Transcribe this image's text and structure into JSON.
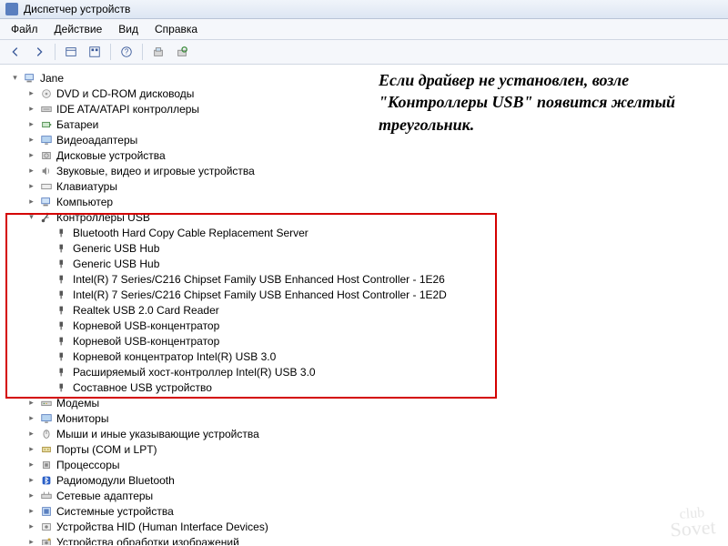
{
  "window": {
    "title": "Диспетчер устройств"
  },
  "menu": {
    "file": "Файл",
    "action": "Действие",
    "view": "Вид",
    "help": "Справка"
  },
  "tree": {
    "root": "Jane",
    "categories": [
      {
        "label": "DVD и CD-ROM дисководы",
        "icon": "disc"
      },
      {
        "label": "IDE ATA/ATAPI контроллеры",
        "icon": "ide"
      },
      {
        "label": "Батареи",
        "icon": "battery"
      },
      {
        "label": "Видеоадаптеры",
        "icon": "display"
      },
      {
        "label": "Дисковые устройства",
        "icon": "disk"
      },
      {
        "label": "Звуковые, видео и игровые устройства",
        "icon": "sound"
      },
      {
        "label": "Клавиатуры",
        "icon": "keyboard"
      },
      {
        "label": "Компьютер",
        "icon": "computer"
      },
      {
        "label": "Контроллеры USB",
        "icon": "usb",
        "expanded": true
      },
      {
        "label": "Модемы",
        "icon": "modem"
      },
      {
        "label": "Мониторы",
        "icon": "monitor"
      },
      {
        "label": "Мыши и иные указывающие устройства",
        "icon": "mouse"
      },
      {
        "label": "Порты (COM и LPT)",
        "icon": "port"
      },
      {
        "label": "Процессоры",
        "icon": "cpu"
      },
      {
        "label": "Радиомодули Bluetooth",
        "icon": "bluetooth"
      },
      {
        "label": "Сетевые адаптеры",
        "icon": "network"
      },
      {
        "label": "Системные устройства",
        "icon": "system"
      },
      {
        "label": "Устройства HID (Human Interface Devices)",
        "icon": "hid"
      },
      {
        "label": "Устройства обработки изображений",
        "icon": "imaging"
      }
    ],
    "usb_children": [
      "Bluetooth Hard Copy Cable Replacement Server",
      "Generic USB Hub",
      "Generic USB Hub",
      "Intel(R) 7 Series/C216 Chipset Family USB Enhanced Host Controller - 1E26",
      "Intel(R) 7 Series/C216 Chipset Family USB Enhanced Host Controller - 1E2D",
      "Realtek USB 2.0 Card Reader",
      "Корневой USB-концентратор",
      "Корневой USB-концентратор",
      "Корневой концентратор Intel(R) USB 3.0",
      "Расширяемый хост-контроллер Intel(R) USB 3.0",
      "Составное USB устройство"
    ]
  },
  "annotation": {
    "text": "Если драйвер не установлен, возле \"Контроллеры USB\" появится желтый треугольник."
  },
  "watermark": {
    "line1": "club",
    "line2": "Sovet"
  }
}
